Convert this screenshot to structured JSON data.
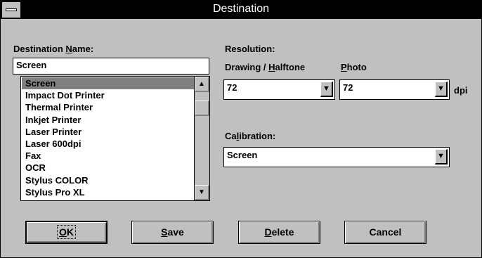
{
  "window": {
    "title": "Destination"
  },
  "destination": {
    "label_pre": "Destination ",
    "label_u": "N",
    "label_post": "ame:",
    "value": "Screen",
    "list": [
      "Screen",
      "Impact Dot Printer",
      "Thermal Printer",
      "Inkjet Printer",
      "Laser Printer",
      "Laser 600dpi",
      "Fax",
      "OCR",
      "Stylus COLOR",
      "Stylus Pro XL"
    ],
    "selected": "Screen"
  },
  "resolution": {
    "label": "Resolution:",
    "drawing_label_pre": "Drawing / ",
    "drawing_label_u": "H",
    "drawing_label_post": "alftone",
    "drawing_value": "72",
    "photo_label_u": "P",
    "photo_label_post": "hoto",
    "photo_value": "72",
    "unit": "dpi"
  },
  "calibration": {
    "label_pre": "Ca",
    "label_u": "l",
    "label_post": "ibration:",
    "value": "Screen"
  },
  "buttons": {
    "ok_u": "O",
    "ok_post": "K",
    "save_u": "S",
    "save_post": "ave",
    "delete_u": "D",
    "delete_post": "elete",
    "cancel": "Cancel"
  },
  "icons": {
    "system_menu": "system-menu-icon",
    "dropdown": "dropdown-arrow-icon",
    "scroll_up": "scroll-up-arrow-icon",
    "scroll_down": "scroll-down-arrow-icon"
  }
}
